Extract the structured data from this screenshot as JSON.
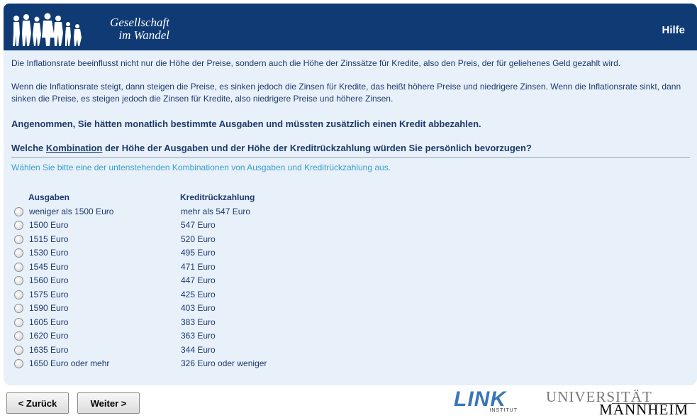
{
  "header": {
    "logo_line1": "Gesellschaft",
    "logo_line2": "im Wandel",
    "help_label": "Hilfe"
  },
  "content": {
    "intro1": "Die Inflationsrate beeinflusst nicht nur die Höhe der Preise, sondern auch die Höhe der Zinssätze für Kredite, also den Preis, der für geliehenes Geld gezahlt wird.",
    "intro2": "Wenn die Inflationsrate steigt, dann steigen die Preise, es sinken jedoch die Zinsen für Kredite, das heißt höhere Preise und niedrigere Zinsen. Wenn die Inflationsrate sinkt, dann sinken die Preise, es steigen jedoch die Zinsen für Kredite, also niedrigere Preise und höhere Zinsen.",
    "question1": "Angenommen, Sie hätten monatlich bestimmte Ausgaben und müssten zusätzlich einen Kredit abbezahlen.",
    "question2_pre": "Welche ",
    "question2_underline": "Kombination",
    "question2_post": " der Höhe der Ausgaben und der Höhe der Kreditrückzahlung würden Sie persönlich bevorzugen?",
    "instruction": "Wählen Sie bitte eine der untenstehenden Kombinationen von Ausgaben und Kreditrückzahlung aus."
  },
  "table": {
    "col_ausgaben": "Ausgaben",
    "col_kredit": "Kreditrückzahlung",
    "options": [
      {
        "ausgaben": "weniger als 1500 Euro",
        "kredit": "mehr als 547 Euro"
      },
      {
        "ausgaben": "1500 Euro",
        "kredit": "547 Euro"
      },
      {
        "ausgaben": "1515 Euro",
        "kredit": "520 Euro"
      },
      {
        "ausgaben": "1530 Euro",
        "kredit": "495 Euro"
      },
      {
        "ausgaben": "1545 Euro",
        "kredit": "471 Euro"
      },
      {
        "ausgaben": "1560 Euro",
        "kredit": "447 Euro"
      },
      {
        "ausgaben": "1575 Euro",
        "kredit": "425 Euro"
      },
      {
        "ausgaben": "1590 Euro",
        "kredit": "403 Euro"
      },
      {
        "ausgaben": "1605 Euro",
        "kredit": "383 Euro"
      },
      {
        "ausgaben": "1620 Euro",
        "kredit": "363 Euro"
      },
      {
        "ausgaben": "1635 Euro",
        "kredit": "344 Euro"
      },
      {
        "ausgaben": "1650 Euro oder mehr",
        "kredit": "326 Euro oder weniger"
      }
    ]
  },
  "nav": {
    "back_label": "< Zurück",
    "next_label": "Weiter >"
  },
  "footer": {
    "link_word": "LINK",
    "link_sub": "INSTITUT",
    "uni_line1": "UNIVERSITÄT",
    "uni_line2": "MANNHEIM"
  },
  "colors": {
    "header_bg": "#0f3a74",
    "panel_bg": "#e8f0fa",
    "text": "#1d3a6b",
    "instruction": "#3aa0c8"
  }
}
